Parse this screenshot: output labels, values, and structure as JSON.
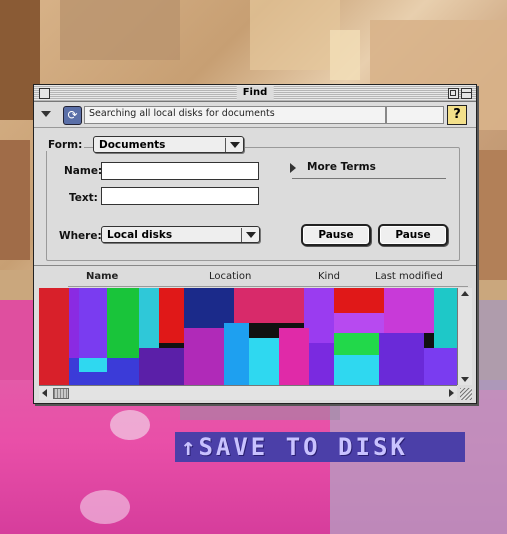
{
  "window": {
    "title": "Find"
  },
  "status": {
    "text": "Searching all local disks for documents"
  },
  "form": {
    "form_label": "Form:",
    "form_value": "Documents",
    "name_label": "Name:",
    "name_value": "",
    "text_label": "Text:",
    "text_value": "",
    "where_label": "Where:",
    "where_value": "Local disks",
    "more_terms_label": "More Terms",
    "pause_button_1": "Pause",
    "pause_button_2": "Pause"
  },
  "columns": {
    "name": "Name",
    "location": "Location",
    "kind": "Kind",
    "last_modified": "Last modified"
  },
  "help": {
    "label": "?"
  },
  "banner": {
    "text": "↑SAVE TO DISK"
  },
  "icons": {
    "sync": "refresh-icon",
    "help": "help-icon",
    "disclosure": "disclosure-triangle-icon"
  },
  "colors": {
    "banner_bg": "#4b3fa8",
    "banner_text": "#c9c2ff",
    "help_bg": "#f3e08a"
  }
}
